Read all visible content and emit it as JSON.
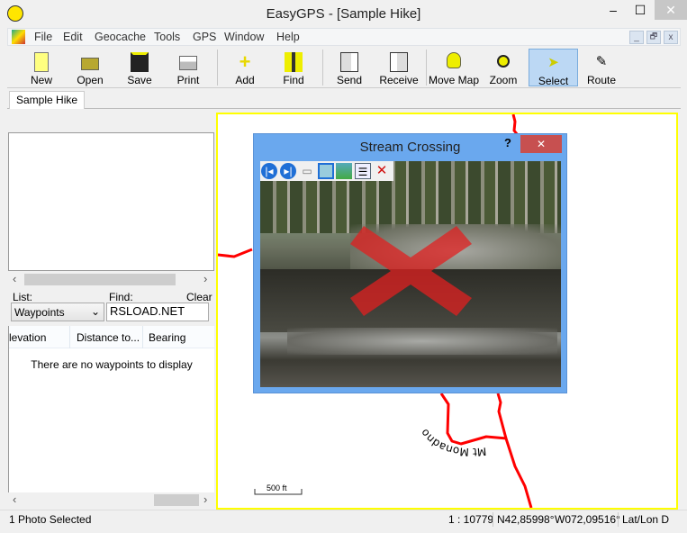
{
  "window": {
    "title": "EasyGPS - [Sample Hike]",
    "minimize": "–",
    "maximize": "☐",
    "close": "✕"
  },
  "menu": [
    "File",
    "Edit",
    "Geocache",
    "Tools",
    "GPS",
    "Window",
    "Help"
  ],
  "mdi_buttons": [
    "_",
    "🗗",
    "x"
  ],
  "toolbar": [
    {
      "label": "New",
      "icon": "new-file-icon"
    },
    {
      "label": "Open",
      "icon": "open-folder-icon"
    },
    {
      "label": "Save",
      "icon": "floppy-disk-icon"
    },
    {
      "label": "Print",
      "icon": "printer-icon"
    },
    {
      "label": "Add",
      "icon": "plus-icon"
    },
    {
      "label": "Find",
      "icon": "binoculars-icon"
    },
    {
      "label": "Send",
      "icon": "send-to-gps-icon"
    },
    {
      "label": "Receive",
      "icon": "receive-from-gps-icon"
    },
    {
      "label": "Move Map",
      "icon": "hand-icon"
    },
    {
      "label": "Zoom",
      "icon": "magnifier-icon"
    },
    {
      "label": "Select",
      "icon": "arrow-cursor-icon",
      "active": true
    },
    {
      "label": "Route",
      "icon": "pencil-icon"
    }
  ],
  "tab": "Sample Hike",
  "left": {
    "list_label": "List:",
    "list_value": "Waypoints",
    "find_label": "Find:",
    "find_value": "RSLOAD.NET",
    "clear": "Clear",
    "columns": [
      "levation",
      "Distance to...",
      "Bearing"
    ],
    "empty_message": "There are no waypoints to display"
  },
  "map": {
    "route_label": "Mt Monadnock Hike",
    "scale_bar": "500 ft",
    "route_color": "#ff0000",
    "border_color": "#ffff00"
  },
  "popup": {
    "title": "Stream Crossing",
    "help": "?",
    "close": "✕"
  },
  "status": {
    "selection": "1 Photo Selected",
    "scale": "1 : 10779",
    "lat": "N42,85998°",
    "lon": "W072,09516°",
    "coord_format": "Lat/Lon D"
  }
}
